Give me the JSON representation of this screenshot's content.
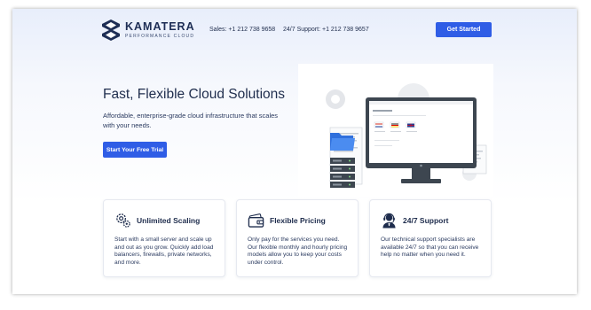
{
  "header": {
    "brand_name": "KAMATERA",
    "brand_tagline": "PERFORMANCE CLOUD",
    "sales": "Sales: +1 212 738 9658",
    "support": "24/7 Support: +1 212 738 9657",
    "cta_label": "Get Started"
  },
  "hero": {
    "title": "Fast, Flexible Cloud Solutions",
    "subtitle": "Affordable, enterprise-grade cloud infrastructure that scales with your needs.",
    "cta_label": "Start Your Free Trial"
  },
  "features": [
    {
      "title": "Unlimited Scaling",
      "icon": "gears-icon",
      "text": "Start with a small server and scale up and out as you grow. Quickly add load balancers, firewalls, private networks, and more."
    },
    {
      "title": "Flexible Pricing",
      "icon": "wallet-icon",
      "text": "Only pay for the services you need. Our flexible monthly and hourly pricing models allow you to keep your costs under control."
    },
    {
      "title": "24/7 Support",
      "icon": "headset-agent-icon",
      "text": "Our technical support specialists are available 24/7 so that you can receive help no matter when you need it."
    }
  ],
  "colors": {
    "accent": "#2f5de6",
    "text_dark": "#1f2d4d",
    "hero_tint": "#e8eefb"
  }
}
